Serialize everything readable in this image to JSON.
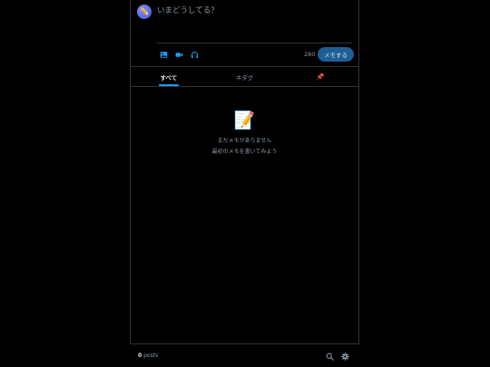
{
  "composer": {
    "placeholder": "いまどうしてる？",
    "avatar_emoji": "✏️",
    "char_count": "280",
    "submit_label": "メモする",
    "tools": [
      "image-icon",
      "video-icon",
      "headphones-icon"
    ]
  },
  "tabs": [
    {
      "label": "すべて",
      "active": true
    },
    {
      "label": "ネタグ",
      "active": false
    },
    {
      "label": "📌",
      "active": false
    }
  ],
  "empty_state": {
    "icon": "📝",
    "line1": "まだメモがありません",
    "line2": "最初のメモを書いてみよう"
  },
  "footer": {
    "count": "0",
    "count_unit": "posts",
    "icons": [
      "search-icon",
      "gear-icon"
    ]
  },
  "colors": {
    "background": "#000000",
    "border": "#2f3336",
    "accent": "#1d9bf0",
    "button": "#1d5f94",
    "muted": "#8b98a5"
  }
}
